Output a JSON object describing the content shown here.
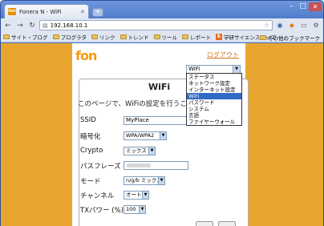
{
  "browser": {
    "tab_title": "Fonera N - WiFi",
    "tab_favicon_text": "fon",
    "url": "192.168.10.1",
    "bookmarks": [
      "サイト・ブログ",
      "プログラタ",
      "リンク",
      "トレンド",
      "ツール",
      "レポート",
      "学研サイエンスキッズ"
    ],
    "bookmarks_other": "その他のブックマーク"
  },
  "page": {
    "logo": "fon",
    "logout": "ログアウト",
    "page_select_value": "WiFi",
    "dropdown_options": [
      "ステータス",
      "ネットワーク設定",
      "インターネット設定",
      "WiFi",
      "パスワード",
      "システム",
      "言語",
      "ファイヤーウォール"
    ],
    "dropdown_selected_index": 3,
    "heading": "WiFi",
    "description": "このページで、WiFiの設定を行うことが",
    "fields": {
      "ssid_label": "SSID",
      "ssid_value": "MyPlace",
      "encryption_label": "暗号化",
      "encryption_value": "WPA/WPA2",
      "crypto_label": "Crypto",
      "crypto_value": "ミックス",
      "passphrase_label": "パスフレーズ",
      "mode_label": "モード",
      "mode_value": "n/g/b ミックス",
      "channel_label": "チャンネル",
      "channel_value": "オート",
      "txpower_label": "TXパワー (%)",
      "txpower_value": "100"
    }
  },
  "colors": {
    "background_orange": "#e9a62e",
    "fon_orange": "#f39a12",
    "link_orange": "#d0731b",
    "selection_blue": "#3169c6"
  }
}
